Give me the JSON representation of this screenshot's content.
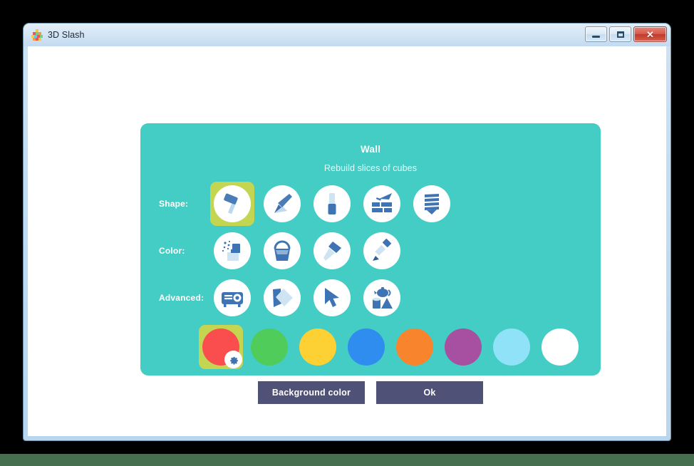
{
  "window": {
    "title": "3D Slash",
    "app_icon": "3d-slash-logo-icon",
    "controls": {
      "minimize_label": "–",
      "maximize_label": "□",
      "close_label": "✕"
    }
  },
  "panel": {
    "title": "Wall",
    "subtitle": "Rebuild slices of cubes",
    "background_color": "#44cdc4",
    "selection_highlight_color": "#c4d551",
    "rows": [
      {
        "key": "shape",
        "label": "Shape:",
        "tools": [
          {
            "name": "hammer-tool",
            "icon": "hammer-icon",
            "selected": true
          },
          {
            "name": "chisel-tool",
            "icon": "chisel-icon",
            "selected": false
          },
          {
            "name": "drill-tool",
            "icon": "drill-icon",
            "selected": false
          },
          {
            "name": "trowel-bricks-tool",
            "icon": "trowel-bricks-icon",
            "selected": false
          },
          {
            "name": "slices-tool",
            "icon": "slices-icon",
            "selected": false
          }
        ]
      },
      {
        "key": "color",
        "label": "Color:",
        "tools": [
          {
            "name": "spray-tool",
            "icon": "spray-icon",
            "selected": false
          },
          {
            "name": "paint-bucket-tool",
            "icon": "paint-bucket-icon",
            "selected": false
          },
          {
            "name": "eyedropper-tool",
            "icon": "eyedropper-icon",
            "selected": false
          },
          {
            "name": "brush-tool",
            "icon": "brush-icon",
            "selected": false
          }
        ]
      },
      {
        "key": "advanced",
        "label": "Advanced:",
        "tools": [
          {
            "name": "projector-tool",
            "icon": "projector-icon",
            "selected": false
          },
          {
            "name": "flag-tool",
            "icon": "flag-icon",
            "selected": false
          },
          {
            "name": "cursor-tool",
            "icon": "cursor-arrow-icon",
            "selected": false
          },
          {
            "name": "shapes-tool",
            "icon": "shapes-teapot-icon",
            "selected": false
          }
        ]
      }
    ],
    "swatches": [
      {
        "name": "swatch-red",
        "color": "#fa4e4e",
        "selected": true,
        "badge": "gear-icon"
      },
      {
        "name": "swatch-green",
        "color": "#4fcc5a",
        "selected": false,
        "badge": null
      },
      {
        "name": "swatch-yellow",
        "color": "#fdd033",
        "selected": false,
        "badge": null
      },
      {
        "name": "swatch-blue",
        "color": "#2f8def",
        "selected": false,
        "badge": null
      },
      {
        "name": "swatch-orange",
        "color": "#f9842e",
        "selected": false,
        "badge": null
      },
      {
        "name": "swatch-purple",
        "color": "#a74fa0",
        "selected": false,
        "badge": null
      },
      {
        "name": "swatch-light-blue",
        "color": "#8fe2f7",
        "selected": false,
        "badge": null
      },
      {
        "name": "swatch-white",
        "color": "#ffffff",
        "selected": false,
        "badge": null
      }
    ]
  },
  "footer": {
    "background_color_label": "Background color",
    "ok_label": "Ok",
    "button_color": "#4f5176"
  }
}
